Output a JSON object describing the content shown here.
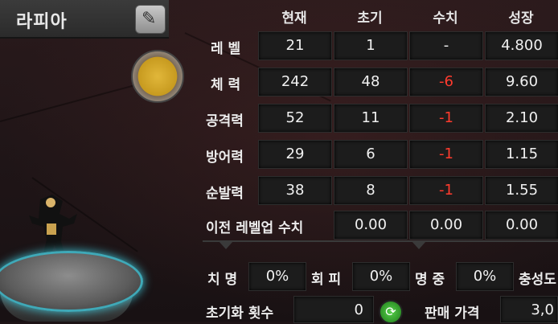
{
  "character": {
    "name": "라피아"
  },
  "colors": {
    "negative": "#ff3b2e",
    "cell_bg": "#1c1c1c",
    "accent": "#3fbfd0"
  },
  "icons": {
    "rename": "quill-pen-icon",
    "emblem": "spiral-emblem-icon",
    "reset": "refresh-icon"
  },
  "stats": {
    "headers": [
      "현재",
      "초기",
      "수치",
      "성장"
    ],
    "rows": [
      {
        "label": "레 벨",
        "current": "21",
        "initial": "1",
        "value": "-",
        "growth": "4.800"
      },
      {
        "label": "체 력",
        "current": "242",
        "initial": "48",
        "value": "-6",
        "growth": "9.60"
      },
      {
        "label": "공격력",
        "current": "52",
        "initial": "11",
        "value": "-1",
        "growth": "2.10"
      },
      {
        "label": "방어력",
        "current": "29",
        "initial": "6",
        "value": "-1",
        "growth": "1.15"
      },
      {
        "label": "순발력",
        "current": "38",
        "initial": "8",
        "value": "-1",
        "growth": "1.55"
      }
    ],
    "prev_levelup": {
      "label": "이전 레벨업 수치",
      "v1": "0.00",
      "v2": "0.00",
      "v3": "0.00"
    }
  },
  "bottom": {
    "crit_label": "치 명",
    "crit_value": "0%",
    "evade_label": "회 피",
    "evade_value": "0%",
    "hit_label": "명 중",
    "hit_value": "0%",
    "loyalty_label": "충성도",
    "reset_count_label": "초기화 횟수",
    "reset_count_value": "0",
    "sell_price_label": "판매 가격",
    "sell_price_value": "3,0"
  }
}
